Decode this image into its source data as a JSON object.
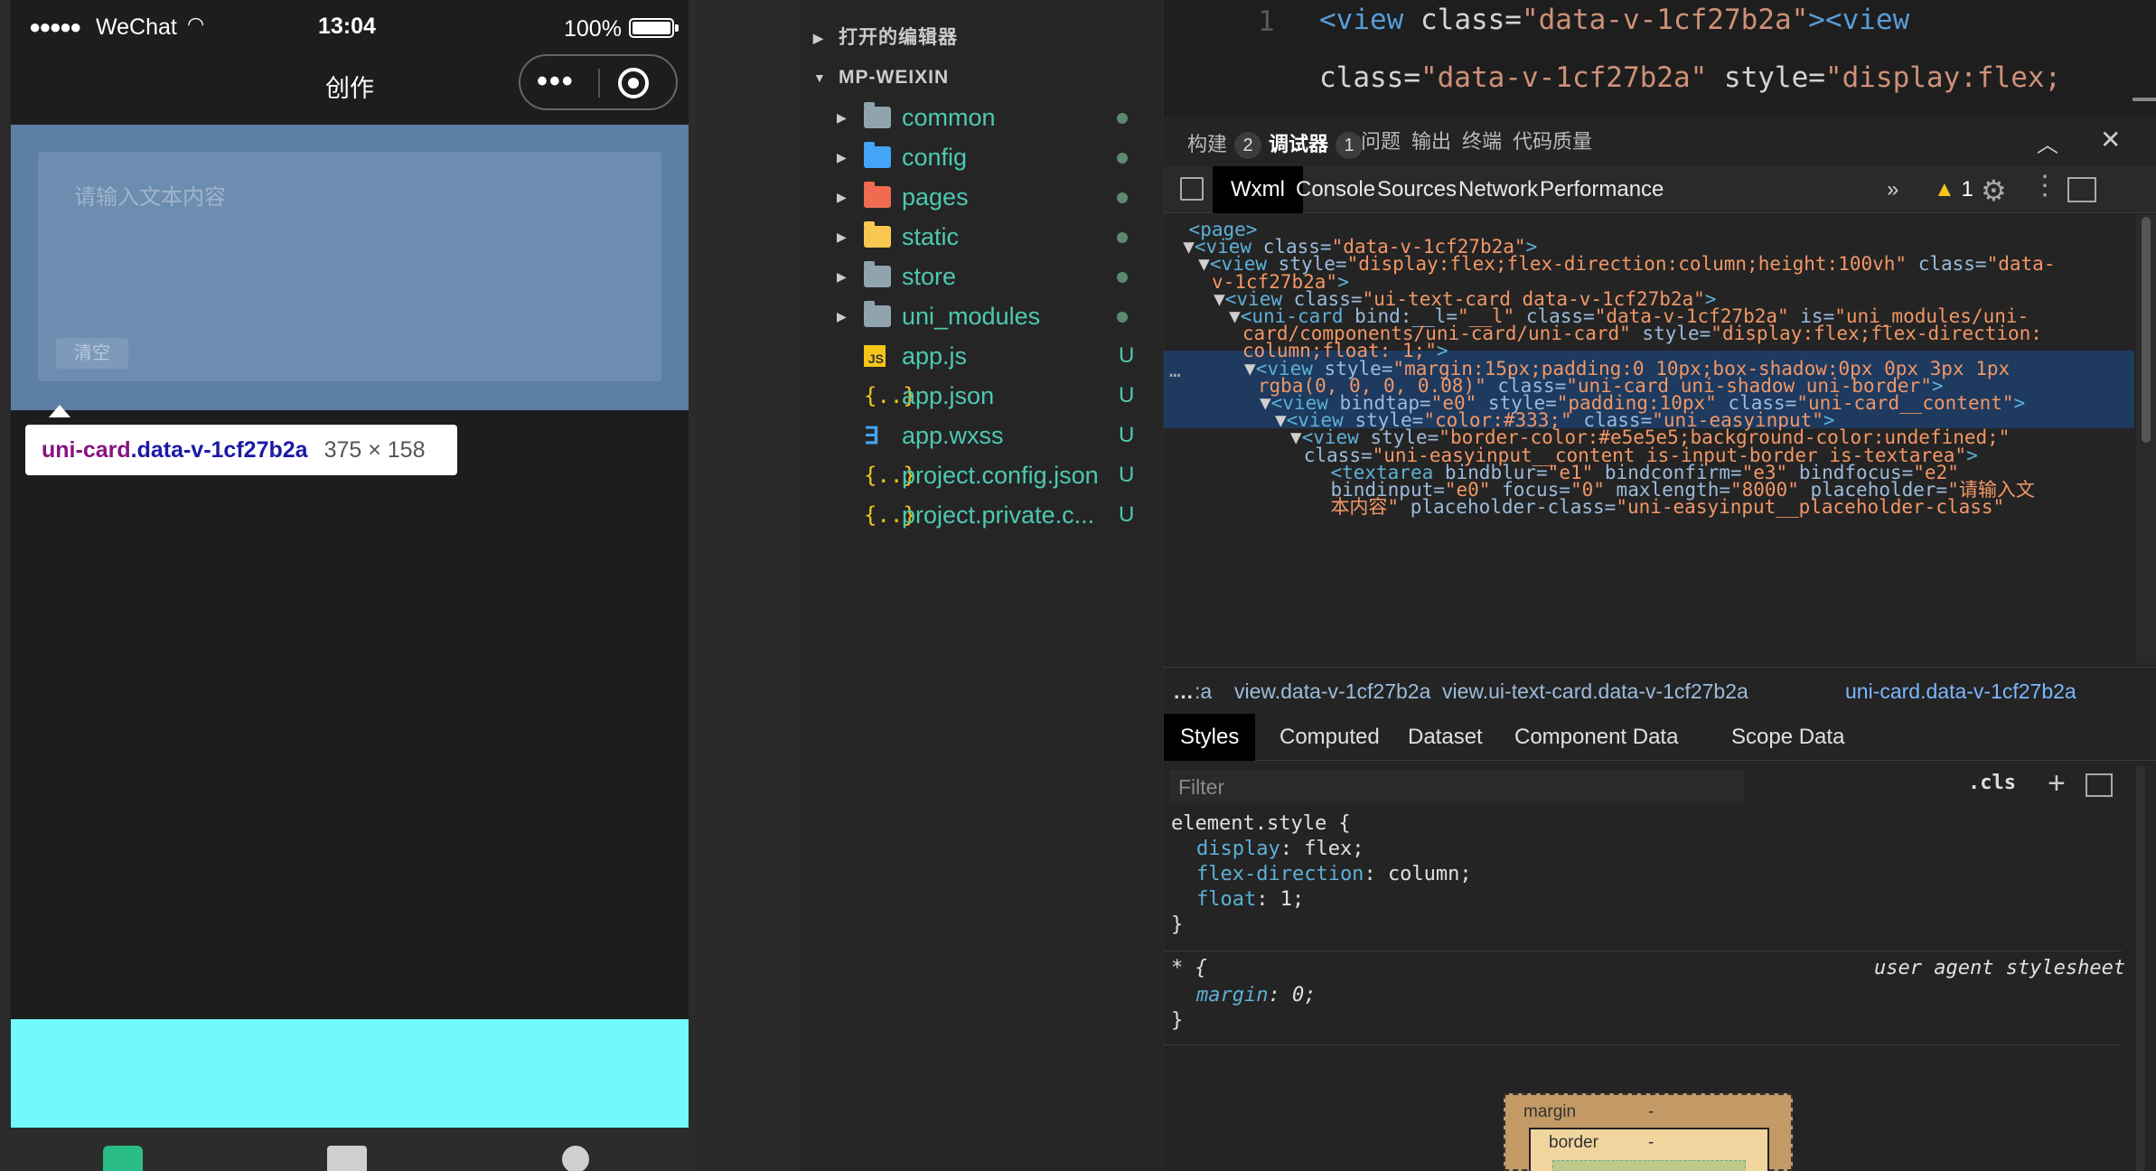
{
  "simulator": {
    "status_bar": {
      "signal": "●●●●●",
      "carrier": "WeChat",
      "time": "13:04",
      "battery_pct": "100%"
    },
    "nav_title": "创作",
    "capsule": {
      "menu_icon": "more-dots-icon",
      "close_icon": "target-circle-icon"
    },
    "textarea_placeholder": "请输入文本内容",
    "clear_button": "清空",
    "tooltip": {
      "tag": "uni-card",
      "cls": ".data-v-1cf27b2a",
      "size": "375 × 158"
    },
    "highlight_color": "#5c7fa3",
    "cyan_color": "#72f9fb"
  },
  "explorer": {
    "open_editors": "打开的编辑器",
    "project": "MP-WEIXIN",
    "items": [
      {
        "name": "common",
        "icon": "folder-icon",
        "status": ""
      },
      {
        "name": "config",
        "icon": "folder-config-icon",
        "status": ""
      },
      {
        "name": "pages",
        "icon": "folder-pages-icon",
        "status": ""
      },
      {
        "name": "static",
        "icon": "folder-static-icon",
        "status": ""
      },
      {
        "name": "store",
        "icon": "folder-icon",
        "status": ""
      },
      {
        "name": "uni_modules",
        "icon": "folder-icon",
        "status": ""
      },
      {
        "name": "app.js",
        "icon": "js-file-icon",
        "status": "U"
      },
      {
        "name": "app.json",
        "icon": "json-file-icon",
        "status": "U"
      },
      {
        "name": "app.wxss",
        "icon": "css-file-icon",
        "status": "U"
      },
      {
        "name": "project.config.json",
        "icon": "json-file-icon",
        "status": "U"
      },
      {
        "name": "project.private.c...",
        "icon": "json-file-icon",
        "status": "U"
      }
    ]
  },
  "editor": {
    "line_number": "1",
    "line1": {
      "t1": "<view",
      "a1": " class=",
      "s1": "\"data-v-1cf27b2a\"",
      "t2": "><view"
    },
    "line2": {
      "a1": "class=",
      "s1": "\"data-v-1cf27b2a\"",
      "a2": " style=",
      "s2": "\"display:flex;"
    }
  },
  "panel_tabs": [
    {
      "label": "构建",
      "badge": "2"
    },
    {
      "label": "调试器",
      "badge": "1"
    },
    {
      "label": "问题",
      "badge": ""
    },
    {
      "label": "输出",
      "badge": ""
    },
    {
      "label": "终端",
      "badge": ""
    },
    {
      "label": "代码质量",
      "badge": ""
    }
  ],
  "devtools_tabs": [
    "Wxml",
    "Console",
    "Sources",
    "Network",
    "Performance"
  ],
  "devtools_more": "»",
  "warnings": {
    "icon": "▲",
    "count": "1"
  },
  "dom_lines": [
    {
      "tg1": "<page>"
    },
    {
      "tw": "▼",
      "tg1": "<view",
      "at1": " class=",
      "st1": "\"data-v-1cf27b2a\"",
      "tg2": ">"
    },
    {
      "tw": "▼",
      "tg1": "<view",
      "at1": " style=",
      "st1": "\"display:flex;flex-direction:column;height:100vh\"",
      "at2": " class=",
      "st2": "\"data-"
    },
    {
      "st1": "v-1cf27b2a\"",
      "tg2": ">"
    },
    {
      "tw": "▼",
      "tg1": "<view",
      "at1": " class=",
      "st1": "\"ui-text-card data-v-1cf27b2a\"",
      "tg2": ">"
    },
    {
      "tw": "▼",
      "tg1": "<uni-card",
      "at1": " bind:__l=",
      "st1": "\"__l\"",
      "at2": " class=",
      "st2": "\"data-v-1cf27b2a\"",
      "at3": " is=",
      "st3": "\"uni_modules/uni-"
    },
    {
      "st1": "card/components/uni-card/uni-card\"",
      "at2": " style=",
      "st2": "\"display:flex;flex-direction:"
    },
    {
      "st1": "column;float: 1;\"",
      "tg2": ">"
    },
    {
      "tw": "▼",
      "tg1": "<view",
      "at1": " style=",
      "st1": "\"margin:15px;padding:0 10px;box-shadow:0px 0px 3px 1px"
    },
    {
      "st1": "rgba(0, 0, 0, 0.08)\"",
      "at2": " class=",
      "st2": "\"uni-card uni-shadow uni-border\"",
      "tg2": ">"
    },
    {
      "tw": "▼",
      "tg1": "<view",
      "at1": " bindtap=",
      "st1": "\"e0\"",
      "at2": " style=",
      "st2": "\"padding:10px\"",
      "at3": " class=",
      "st3": "\"uni-card__content\"",
      "tg2": ">"
    },
    {
      "tw": "▼",
      "tg1": "<view",
      "at1": " style=",
      "st1": "\"color:#333;\"",
      "at2": " class=",
      "st2": "\"uni-easyinput\"",
      "tg2": ">"
    },
    {
      "tw": "▼",
      "tg1": "<view",
      "at1": " style=",
      "st1": "\"border-color:#e5e5e5;background-color:undefined;\""
    },
    {
      "at1": "class=",
      "st1": "\"uni-easyinput__content is-input-border is-textarea\"",
      "tg2": ">"
    },
    {
      "tg1": "<textarea",
      "at1": " bindblur=",
      "st1": "\"e1\"",
      "at2": " bindconfirm=",
      "st2": "\"e3\"",
      "at3": " bindfocus=",
      "st3": "\"e2\""
    },
    {
      "at1": "bindinput=",
      "st1": "\"e0\"",
      "at2": " focus=",
      "st2": "\"0\"",
      "at3": " maxlength=",
      "st3": "\"8000\"",
      "at4": " placeholder=",
      "st4": "\"请输入文"
    },
    {
      "st1": "本内容\"",
      "at2": " placeholder-class=",
      "st2": "\"uni-easyinput__placeholder-class\""
    }
  ],
  "dom_ellipsis": "…",
  "breadcrumbs": {
    "ellipsis": "…",
    "items": [
      ":a",
      "view.data-v-1cf27b2a",
      "view.ui-text-card.data-v-1cf27b2a",
      "uni-card.data-v-1cf27b2a"
    ]
  },
  "style_tabs": [
    "Styles",
    "Computed",
    "Dataset",
    "Component Data",
    "Scope Data"
  ],
  "filter_placeholder": "Filter",
  "cls_label": ".cls",
  "plus_label": "+",
  "styles": {
    "element_selector": "element.style {",
    "rules": [
      {
        "prop": "display",
        "value": "flex;"
      },
      {
        "prop": "flex-direction",
        "value": "column;"
      },
      {
        "prop": "float",
        "value": "1;"
      }
    ],
    "close": "}",
    "ua_selector": "* {",
    "ua_label": "user agent stylesheet",
    "ua_prop": "margin",
    "ua_value": "0;"
  },
  "box_model": {
    "margin_label": "margin",
    "margin_value": "-",
    "border_label": "border",
    "border_value": "-"
  }
}
